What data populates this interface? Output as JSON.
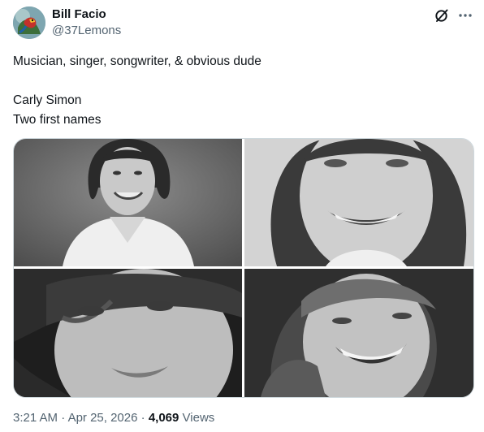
{
  "author": {
    "name": "Bill Facio",
    "handle": "@37Lemons"
  },
  "tweet": {
    "lines": [
      "Musician, singer, songwriter, & obvious dude",
      "Carly Simon",
      "Two first names"
    ]
  },
  "icons": {
    "grok": "grok-slash-icon",
    "more": "more-dots-icon"
  },
  "media": {
    "photos": [
      {
        "position": "top-left"
      },
      {
        "position": "top-right"
      },
      {
        "position": "bottom-left"
      },
      {
        "position": "bottom-right"
      }
    ]
  },
  "meta": {
    "time": "3:21 AM",
    "separator1": " · ",
    "date": "Apr 25, 2026",
    "separator2": " · ",
    "views_count": "4,069",
    "views_label": "Views"
  },
  "colors": {
    "text_primary": "#0f1419",
    "text_secondary": "#536471",
    "border": "#cfd9de"
  }
}
